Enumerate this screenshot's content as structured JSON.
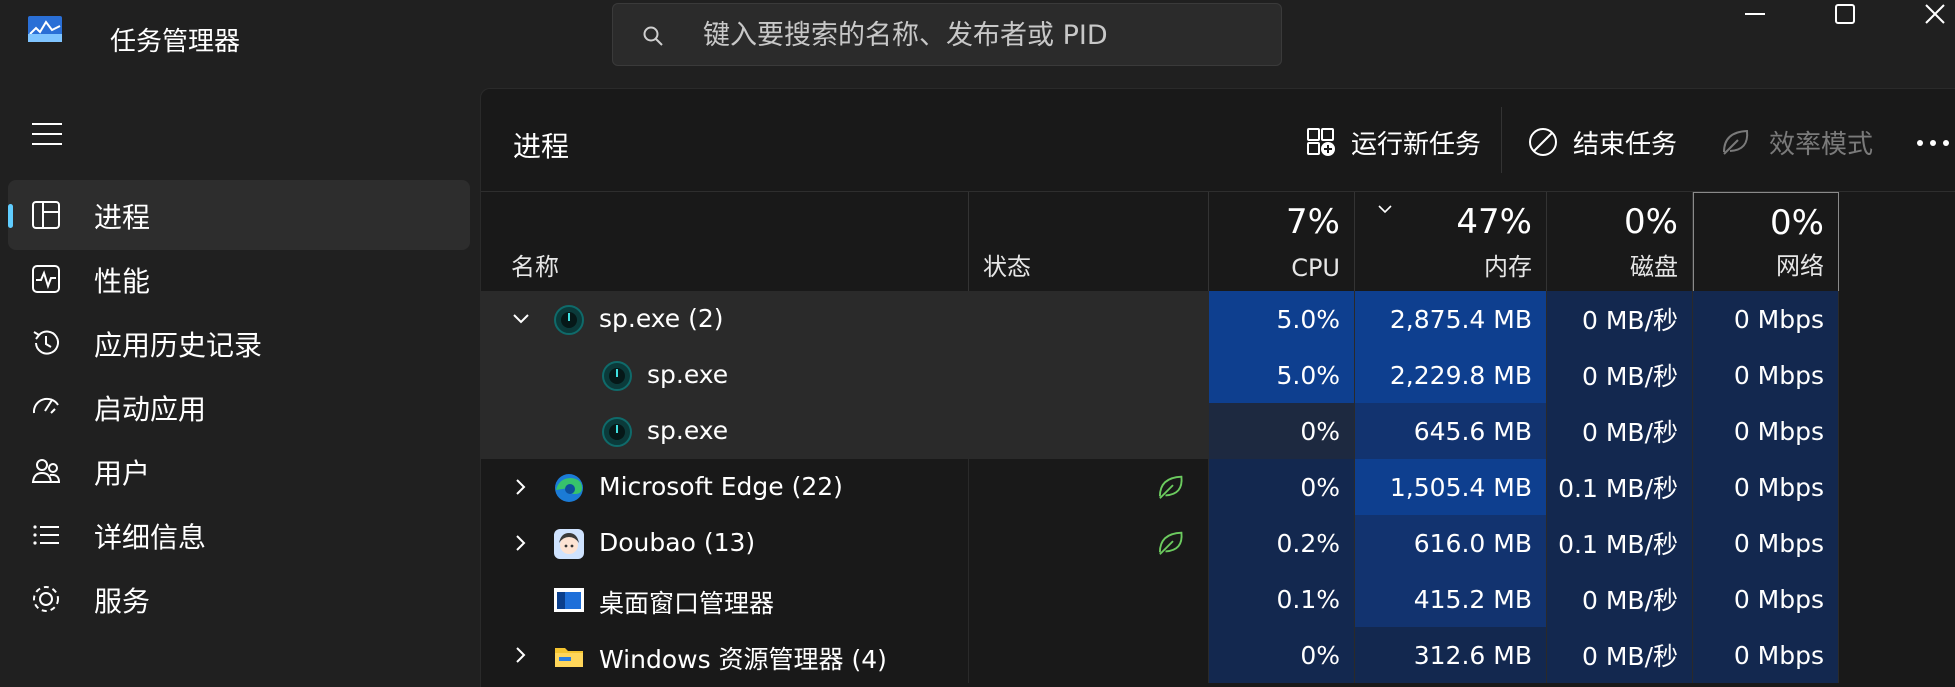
{
  "app": {
    "title": "任务管理器",
    "search_placeholder": "键入要搜索的名称、发布者或 PID"
  },
  "sidebar": {
    "items": [
      {
        "label": "进程",
        "icon": "processes-icon",
        "active": true
      },
      {
        "label": "性能",
        "icon": "performance-icon"
      },
      {
        "label": "应用历史记录",
        "icon": "app-history-icon"
      },
      {
        "label": "启动应用",
        "icon": "startup-apps-icon"
      },
      {
        "label": "用户",
        "icon": "users-icon"
      },
      {
        "label": "详细信息",
        "icon": "details-icon"
      },
      {
        "label": "服务",
        "icon": "services-icon"
      }
    ]
  },
  "page": {
    "title": "进程",
    "toolbar": {
      "run_new_task": "运行新任务",
      "end_task": "结束任务",
      "efficiency_mode": "效率模式"
    }
  },
  "columns": {
    "name": "名称",
    "status": "状态",
    "cpu": {
      "pct": "7%",
      "label": "CPU"
    },
    "memory": {
      "pct": "47%",
      "label": "内存"
    },
    "disk": {
      "pct": "0%",
      "label": "磁盘"
    },
    "network": {
      "pct": "0%",
      "label": "网络"
    }
  },
  "processes": [
    {
      "name": "sp.exe (2)",
      "cpu": "5.0%",
      "memory": "2,875.4 MB",
      "disk": "0 MB/秒",
      "network": "0 Mbps",
      "expanded": true
    },
    {
      "name": "sp.exe",
      "cpu": "5.0%",
      "memory": "2,229.8 MB",
      "disk": "0 MB/秒",
      "network": "0 Mbps"
    },
    {
      "name": "sp.exe",
      "cpu": "0%",
      "memory": "645.6 MB",
      "disk": "0 MB/秒",
      "network": "0 Mbps"
    },
    {
      "name": "Microsoft Edge (22)",
      "cpu": "0%",
      "memory": "1,505.4 MB",
      "disk": "0.1 MB/秒",
      "network": "0 Mbps",
      "efficiency": true
    },
    {
      "name": "Doubao (13)",
      "cpu": "0.2%",
      "memory": "616.0 MB",
      "disk": "0.1 MB/秒",
      "network": "0 Mbps",
      "efficiency": true
    },
    {
      "name": "桌面窗口管理器",
      "cpu": "0.1%",
      "memory": "415.2 MB",
      "disk": "0 MB/秒",
      "network": "0 Mbps"
    },
    {
      "name": "Windows 资源管理器 (4)",
      "cpu": "0%",
      "memory": "312.6 MB",
      "disk": "0 MB/秒",
      "network": "0 Mbps"
    }
  ],
  "colors": {
    "accent": "#60cdff",
    "heat_high": "#0e3f8f",
    "heat_mid": "#12336f",
    "heat_low": "#13284f",
    "efficiency_leaf": "#6ccb5f"
  }
}
